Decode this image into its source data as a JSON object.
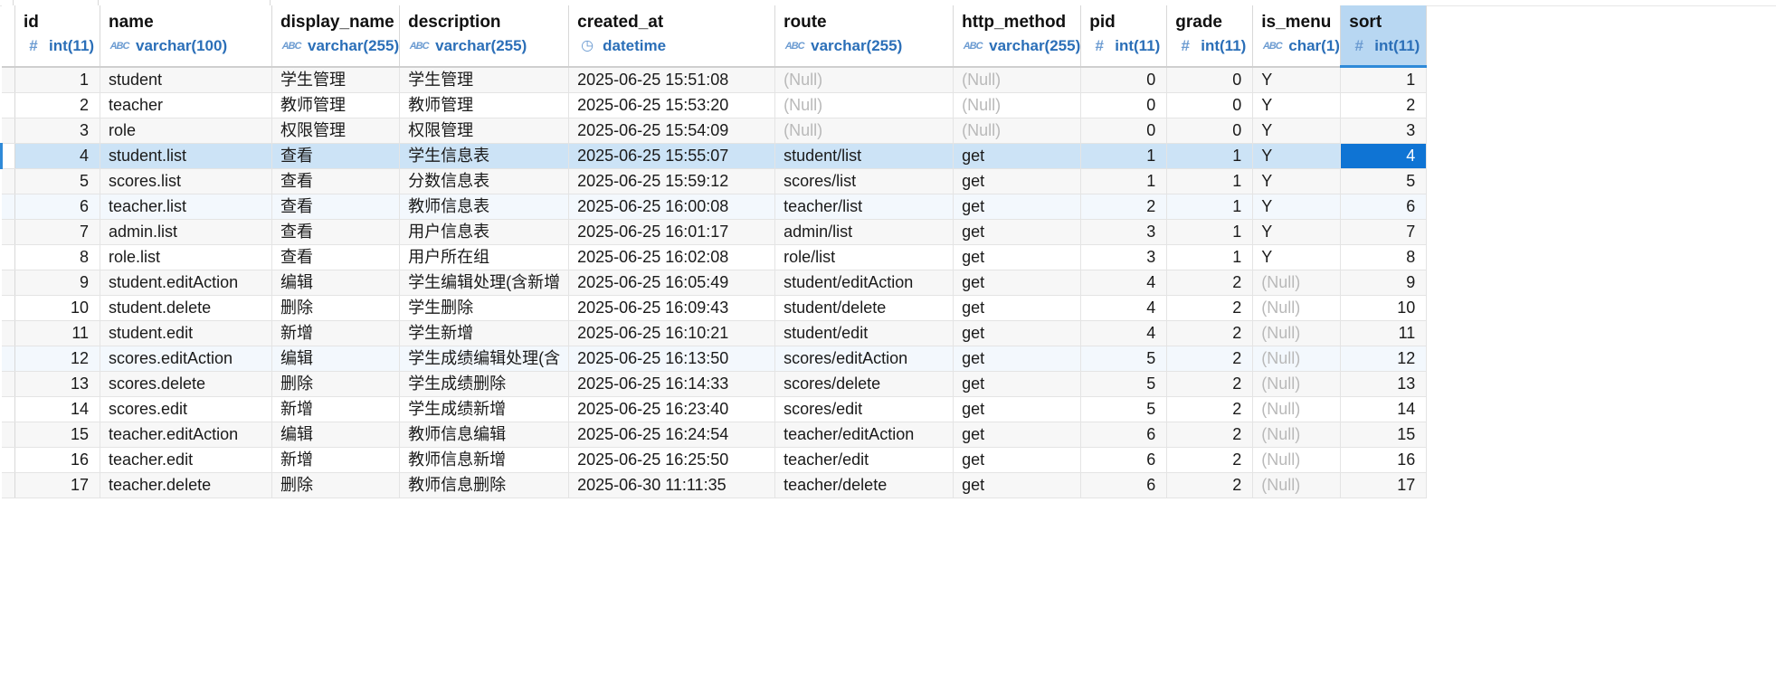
{
  "columns": [
    {
      "name": "id",
      "type": "int(11)",
      "icon": "hash-icon",
      "numeric": true
    },
    {
      "name": "name",
      "type": "varchar(100)",
      "icon": "abc-icon",
      "numeric": false
    },
    {
      "name": "display_name",
      "type": "varchar(255)",
      "icon": "abc-icon",
      "numeric": false
    },
    {
      "name": "description",
      "type": "varchar(255)",
      "icon": "abc-icon",
      "numeric": false
    },
    {
      "name": "created_at",
      "type": "datetime",
      "icon": "clock-icon",
      "numeric": false
    },
    {
      "name": "route",
      "type": "varchar(255)",
      "icon": "abc-icon",
      "numeric": false
    },
    {
      "name": "http_method",
      "type": "varchar(255)",
      "icon": "abc-icon",
      "numeric": false
    },
    {
      "name": "pid",
      "type": "int(11)",
      "icon": "hash-icon",
      "numeric": true
    },
    {
      "name": "grade",
      "type": "int(11)",
      "icon": "hash-icon",
      "numeric": true
    },
    {
      "name": "is_menu",
      "type": "char(1)",
      "icon": "abc-icon",
      "numeric": false
    },
    {
      "name": "sort",
      "type": "int(11)",
      "icon": "hash-icon",
      "numeric": true
    }
  ],
  "null_text": "(Null)",
  "selected_column": "sort",
  "current_row": 3,
  "colors": {
    "accent": "#0f74d4",
    "selected_header": "#b8d7f2",
    "current_row": "#cce3f6",
    "null": "#b9b9b9"
  },
  "rows": [
    [
      "1",
      "student",
      "学生管理",
      "学生管理",
      "2025-06-25 15:51:08",
      null,
      null,
      "0",
      "0",
      "Y",
      "1"
    ],
    [
      "2",
      "teacher",
      "教师管理",
      "教师管理",
      "2025-06-25 15:53:20",
      null,
      null,
      "0",
      "0",
      "Y",
      "2"
    ],
    [
      "3",
      "role",
      "权限管理",
      "权限管理",
      "2025-06-25 15:54:09",
      null,
      null,
      "0",
      "0",
      "Y",
      "3"
    ],
    [
      "4",
      "student.list",
      "查看",
      "学生信息表",
      "2025-06-25 15:55:07",
      "student/list",
      "get",
      "1",
      "1",
      "Y",
      "4"
    ],
    [
      "5",
      "scores.list",
      "查看",
      "分数信息表",
      "2025-06-25 15:59:12",
      "scores/list",
      "get",
      "1",
      "1",
      "Y",
      "5"
    ],
    [
      "6",
      "teacher.list",
      "查看",
      "教师信息表",
      "2025-06-25 16:00:08",
      "teacher/list",
      "get",
      "2",
      "1",
      "Y",
      "6"
    ],
    [
      "7",
      "admin.list",
      "查看",
      "用户信息表",
      "2025-06-25 16:01:17",
      "admin/list",
      "get",
      "3",
      "1",
      "Y",
      "7"
    ],
    [
      "8",
      "role.list",
      "查看",
      "用户所在组",
      "2025-06-25 16:02:08",
      "role/list",
      "get",
      "3",
      "1",
      "Y",
      "8"
    ],
    [
      "9",
      "student.editAction",
      "编辑",
      "学生编辑处理(含新增",
      "2025-06-25 16:05:49",
      "student/editAction",
      "get",
      "4",
      "2",
      null,
      "9"
    ],
    [
      "10",
      "student.delete",
      "删除",
      "学生删除",
      "2025-06-25 16:09:43",
      "student/delete",
      "get",
      "4",
      "2",
      null,
      "10"
    ],
    [
      "11",
      "student.edit",
      "新增",
      "学生新增",
      "2025-06-25 16:10:21",
      "student/edit",
      "get",
      "4",
      "2",
      null,
      "11"
    ],
    [
      "12",
      "scores.editAction",
      "编辑",
      "学生成绩编辑处理(含",
      "2025-06-25 16:13:50",
      "scores/editAction",
      "get",
      "5",
      "2",
      null,
      "12"
    ],
    [
      "13",
      "scores.delete",
      "删除",
      "学生成绩删除",
      "2025-06-25 16:14:33",
      "scores/delete",
      "get",
      "5",
      "2",
      null,
      "13"
    ],
    [
      "14",
      "scores.edit",
      "新增",
      "学生成绩新增",
      "2025-06-25 16:23:40",
      "scores/edit",
      "get",
      "5",
      "2",
      null,
      "14"
    ],
    [
      "15",
      "teacher.editAction",
      "编辑",
      "教师信息编辑",
      "2025-06-25 16:24:54",
      "teacher/editAction",
      "get",
      "6",
      "2",
      null,
      "15"
    ],
    [
      "16",
      "teacher.edit",
      "新增",
      "教师信息新增",
      "2025-06-25 16:25:50",
      "teacher/edit",
      "get",
      "6",
      "2",
      null,
      "16"
    ],
    [
      "17",
      "teacher.delete",
      "删除",
      "教师信息删除",
      "2025-06-30 11:11:35",
      "teacher/delete",
      "get",
      "6",
      "2",
      null,
      "17"
    ]
  ]
}
